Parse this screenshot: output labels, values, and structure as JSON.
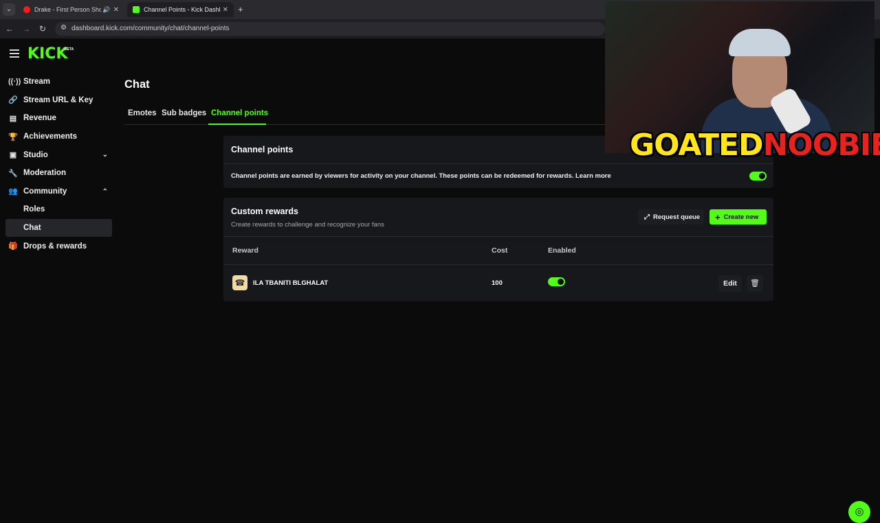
{
  "browser": {
    "tabs": [
      {
        "title": "Drake - First Person Shooter",
        "favicon": "youtube-icon"
      },
      {
        "title": "Channel Points - Kick Dashboard",
        "favicon": "kick-icon"
      }
    ],
    "url": "dashboard.kick.com/community/chat/channel-points"
  },
  "brand": {
    "logo": "KICK",
    "beta": "BETA",
    "accent": "#53fc18"
  },
  "sidebar": {
    "items": [
      {
        "label": "Stream",
        "icon": "broadcast-icon"
      },
      {
        "label": "Stream URL & Key",
        "icon": "link-icon"
      },
      {
        "label": "Revenue",
        "icon": "chart-icon"
      },
      {
        "label": "Achievements",
        "icon": "trophy-icon"
      },
      {
        "label": "Studio",
        "icon": "studio-icon"
      },
      {
        "label": "Moderation",
        "icon": "wrench-icon"
      },
      {
        "label": "Community",
        "icon": "people-icon"
      },
      {
        "label": "Roles"
      },
      {
        "label": "Chat"
      },
      {
        "label": "Drops & rewards",
        "icon": "gift-icon"
      }
    ]
  },
  "main": {
    "title": "Chat",
    "tabs": [
      "Emotes",
      "Sub badges",
      "Channel points"
    ],
    "channel_points": {
      "title": "Channel points",
      "description": "Channel points are earned by viewers for activity on your channel. These points can be redeemed for rewards. Learn more",
      "enabled": true
    },
    "custom_rewards": {
      "title": "Custom rewards",
      "subtitle": "Create rewards to challenge and recognize your fans",
      "request_queue_label": "Request queue",
      "create_new_label": "Create new",
      "columns": [
        "Reward",
        "Cost",
        "Enabled"
      ],
      "rows": [
        {
          "name": "ILA TBANITI BLGHALAT",
          "cost": "100",
          "enabled": true,
          "edit_label": "Edit"
        }
      ]
    }
  },
  "overlay": {
    "text_part1": "GOATED",
    "text_part2": "NOOBIE"
  }
}
